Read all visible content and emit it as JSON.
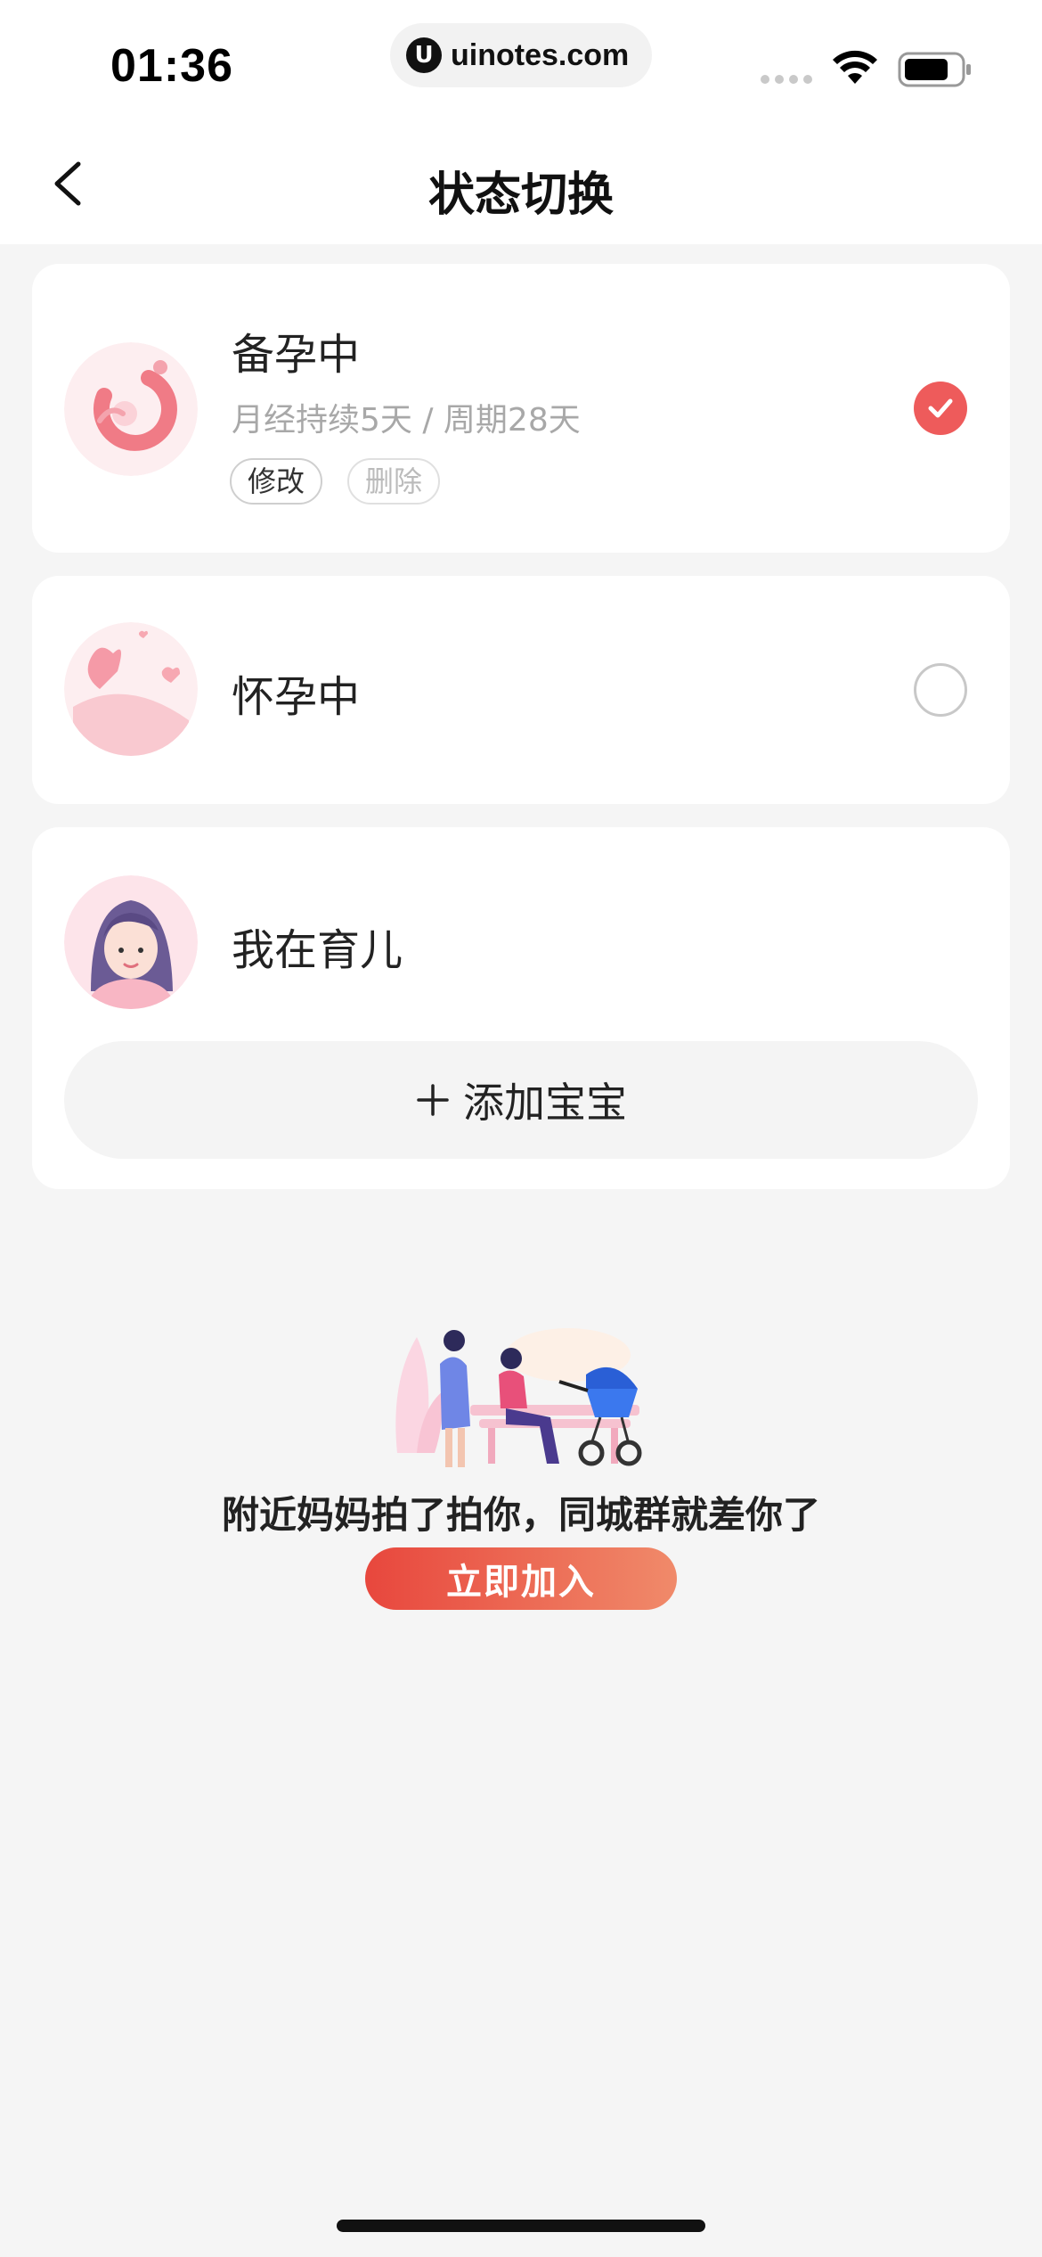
{
  "status_bar": {
    "time": "01:36",
    "url": "uinotes.com",
    "url_logo": "U"
  },
  "nav": {
    "title": "状态切换",
    "back_icon": "chevron-left-icon"
  },
  "cards": [
    {
      "title": "备孕中",
      "subtitle": "月经持续5天 / 周期28天",
      "edit_label": "修改",
      "delete_label": "删除",
      "selected": true
    },
    {
      "title": "怀孕中",
      "selected": false
    },
    {
      "title": "我在育儿",
      "add_label": "添加宝宝"
    }
  ],
  "promo": {
    "text": "附近妈妈拍了拍你，同城群就差你了",
    "button_label": "立即加入"
  },
  "colors": {
    "accent": "#ee5b5b",
    "button_gradient_start": "#e8473d",
    "button_gradient_end": "#f08a6a",
    "background": "#f5f5f5"
  }
}
